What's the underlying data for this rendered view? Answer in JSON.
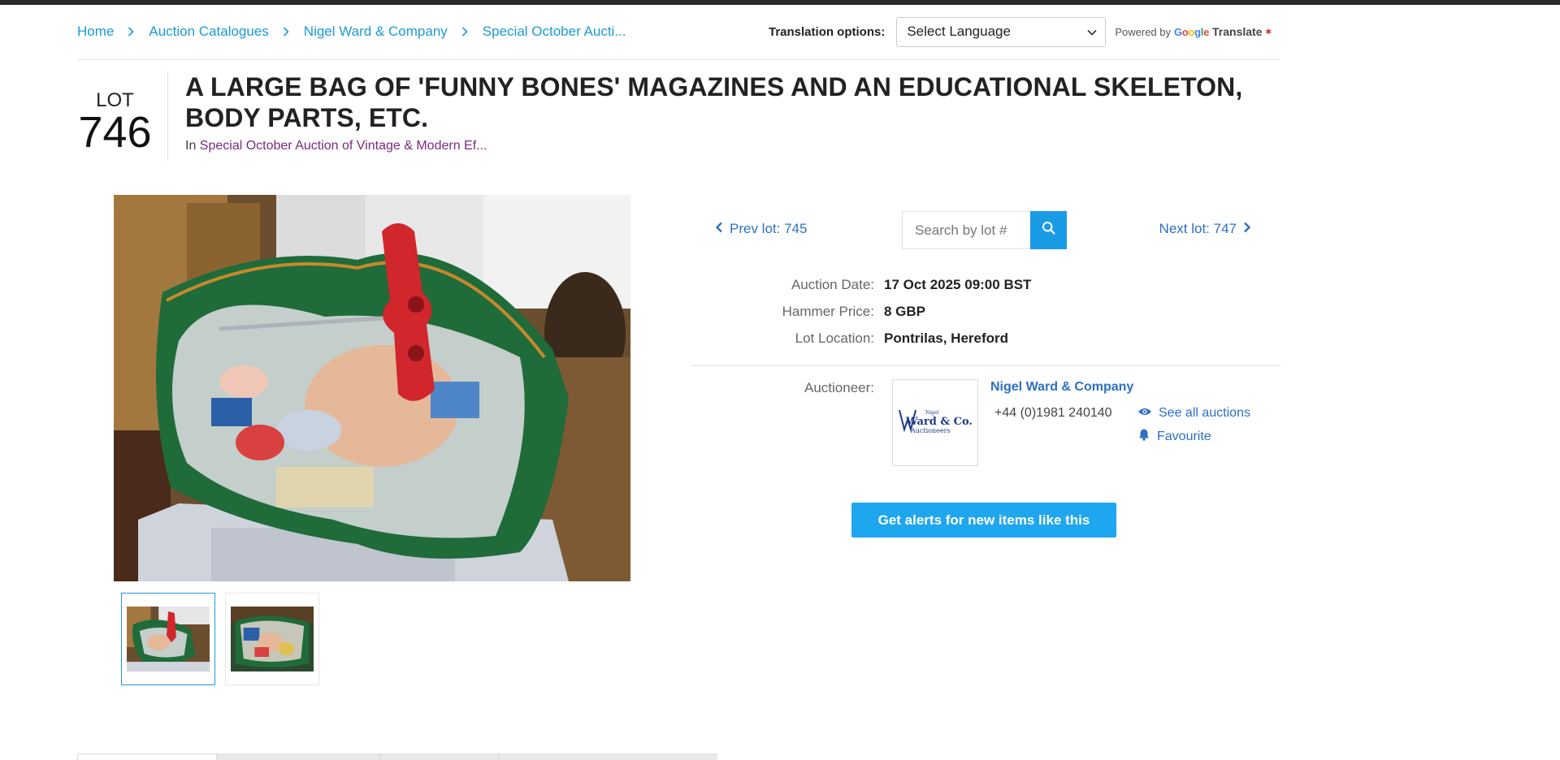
{
  "breadcrumb": {
    "items": [
      "Home",
      "Auction Catalogues",
      "Nigel Ward & Company",
      "Special October Aucti..."
    ]
  },
  "translate": {
    "label": "Translation options:",
    "select_value": "Select Language",
    "powered_by": "Powered by",
    "google": "Google",
    "brand": "Translate"
  },
  "lot": {
    "word": "LOT",
    "number": "746",
    "title": "A LARGE BAG OF 'FUNNY BONES' MAGAZINES AND AN EDUCATIONAL SKELETON, BODY PARTS, ETC.",
    "subtitle_prefix": "In",
    "subtitle_link": "Special October Auction of Vintage & Modern Ef..."
  },
  "gallery": {
    "thumb_count": 2,
    "active_index": 0
  },
  "lot_nav": {
    "prev_label": "Prev lot: 745",
    "search_placeholder": "Search by lot #",
    "next_label": "Next lot: 747"
  },
  "details": [
    {
      "label": "Auction Date:",
      "value": "17 Oct 2025 09:00 BST"
    },
    {
      "label": "Hammer Price:",
      "value": "8 GBP"
    },
    {
      "label": "Lot Location:",
      "value": "Pontrilas, Hereford"
    }
  ],
  "auctioneer": {
    "label": "Auctioneer:",
    "name": "Nigel Ward & Company",
    "phone": "+44 (0)1981 240140",
    "see_all": "See all auctions",
    "favourite": "Favourite",
    "logo_top": "Nigel",
    "logo_main": "Ward & Co.",
    "logo_sub": "Auctioneers"
  },
  "alerts_button": "Get alerts for new items like this",
  "colors": {
    "link_blue": "#1a9ad6",
    "nav_blue": "#2d6fc4",
    "subtitle_purple": "#7a2a7d",
    "button_blue": "#1ea6ee"
  }
}
